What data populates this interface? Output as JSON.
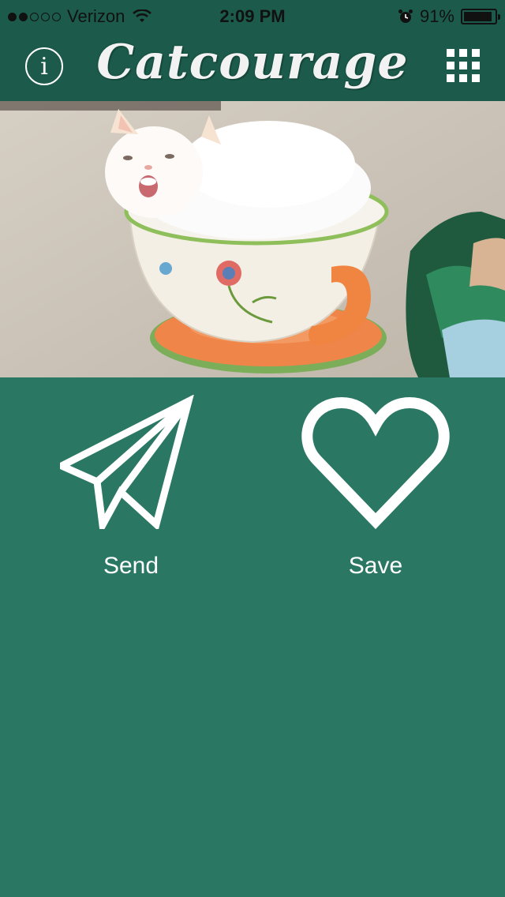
{
  "status_bar": {
    "carrier": "Verizon",
    "time": "2:09 PM",
    "battery": "91%",
    "battery_level": 0.91,
    "signal_bars": 2,
    "signal_total": 5
  },
  "header": {
    "title": "Catcourage",
    "info_icon": "info-icon",
    "grid_icon": "grid-icon"
  },
  "actions": {
    "send_label": "Send",
    "save_label": "Save",
    "send_icon": "paper-plane-icon",
    "save_icon": "heart-icon"
  },
  "colors": {
    "header_bg": "#1c5b4b",
    "body_bg": "#2a7864",
    "icon": "#ffffff"
  }
}
